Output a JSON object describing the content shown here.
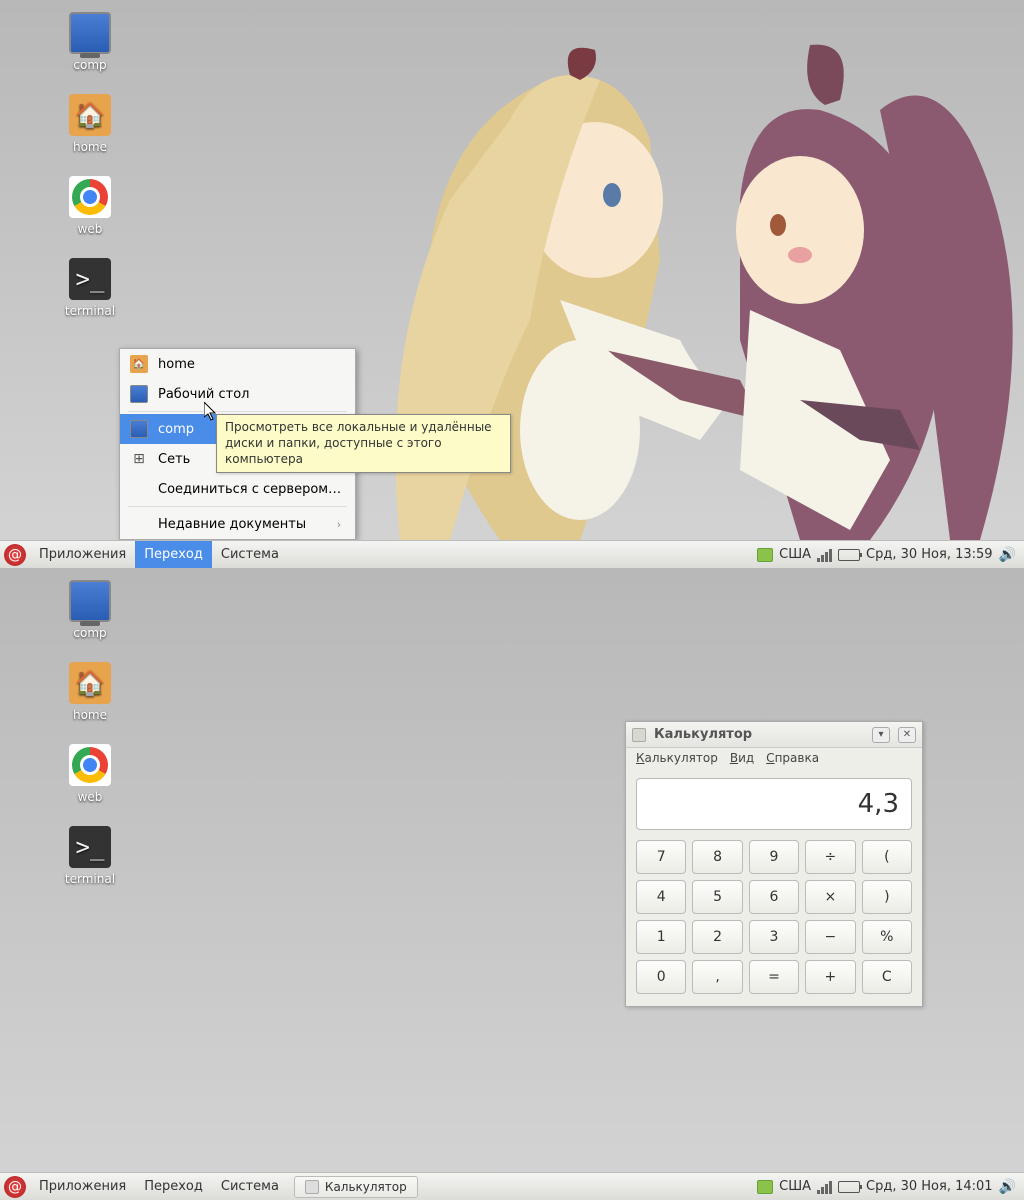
{
  "desktop_icons": [
    {
      "label": "comp",
      "kind": "monitor"
    },
    {
      "label": "home",
      "kind": "folder"
    },
    {
      "label": "web",
      "kind": "chrome"
    },
    {
      "label": "terminal",
      "kind": "terminal"
    }
  ],
  "top": {
    "panel_menus": [
      "Приложения",
      "Переход",
      "Система"
    ],
    "active_menu": "Переход",
    "tray": {
      "keyboard": "США",
      "datetime": "Срд, 30 Ноя, 13:59"
    },
    "popup": {
      "items": [
        {
          "label": "home",
          "icon": "folder"
        },
        {
          "label": "Рабочий стол",
          "icon": "monitor"
        },
        {
          "sep": true
        },
        {
          "label": "comp",
          "icon": "monitor",
          "selected": true
        },
        {
          "label": "Сеть",
          "icon": "network"
        },
        {
          "label": "Соединиться с сервером…",
          "icon": ""
        },
        {
          "label": "Недавние документы",
          "icon": "",
          "submenu": true
        }
      ],
      "tooltip": "Просмотреть все локальные и удалённые диски и папки, доступные с этого компьютера"
    }
  },
  "bottom": {
    "panel_menus": [
      "Приложения",
      "Переход",
      "Система"
    ],
    "taskbar_app": "Калькулятор",
    "tray": {
      "keyboard": "США",
      "datetime": "Срд, 30 Ноя, 14:01"
    },
    "calc": {
      "title": "Калькулятор",
      "menus": {
        "m1": "Калькулятор",
        "m2": "Вид",
        "m3": "Справка"
      },
      "display": "4,3",
      "buttons": [
        "7",
        "8",
        "9",
        "÷",
        "(",
        "4",
        "5",
        "6",
        "×",
        ")",
        "1",
        "2",
        "3",
        "−",
        "%",
        "0",
        ",",
        "=",
        "+",
        "C"
      ]
    }
  }
}
